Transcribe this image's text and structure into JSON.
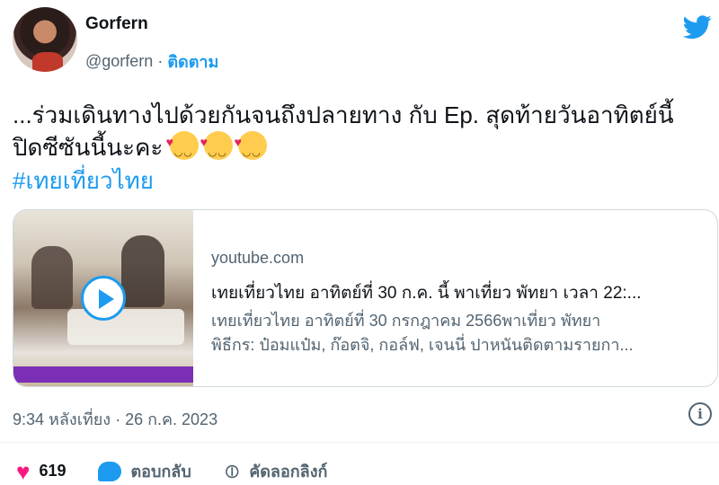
{
  "author": {
    "name": "Gorfern",
    "handle": "@gorfern",
    "separator": "·",
    "follow_label": "ติดตาม"
  },
  "tweet": {
    "text": "...ร่วมเดินทางไปด้วยกันจนถึงปลายทาง กับ Ep. สุดท้ายวันอาทิตย์นี้ ปิดซีซันนี้นะคะ",
    "emoji_icons": [
      "smiling-face-with-hearts-icon",
      "smiling-face-with-hearts-icon",
      "smiling-face-with-hearts-icon"
    ],
    "hashtag": "#เทยเที่ยวไทย"
  },
  "card": {
    "domain": "youtube.com",
    "title": "เทยเที่ยวไทย อาทิตย์ที่ 30 ก.ค. นี้ พาเที่ยว พัทยา เวลา 22:...",
    "description_line1": "เทยเที่ยวไทย อาทิตย์ที่ 30 กรกฎาคม 2566พาเที่ยว พัทยา",
    "description_line2": "พิธีกร: ป๋อมแป๋ม, ก๊อตจิ, กอล์ฟ, เจนนี่ ปาหนันติดตามรายกา..."
  },
  "timestamp": "9:34 หลังเที่ยง · 26 ก.ค. 2023",
  "actions": {
    "like_count": "619",
    "reply_label": "ตอบกลับ",
    "copy_link_label": "คัดลอกลิงก์"
  },
  "colors": {
    "accent": "#1d9bf0",
    "like": "#f91880",
    "text": "#0f1419",
    "muted": "#536471"
  }
}
